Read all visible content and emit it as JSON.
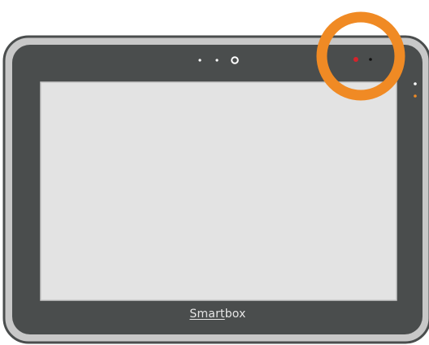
{
  "device": {
    "brand_part1": "Smart",
    "brand_part2": "box"
  },
  "colors": {
    "bezel": "#4a4d4d",
    "bezel_edge": "#c8c8c8",
    "screen": "#e3e3e3",
    "highlight_ring": "#f08a24",
    "sensor_red": "#d6232b",
    "led_orange": "#f08a24"
  }
}
